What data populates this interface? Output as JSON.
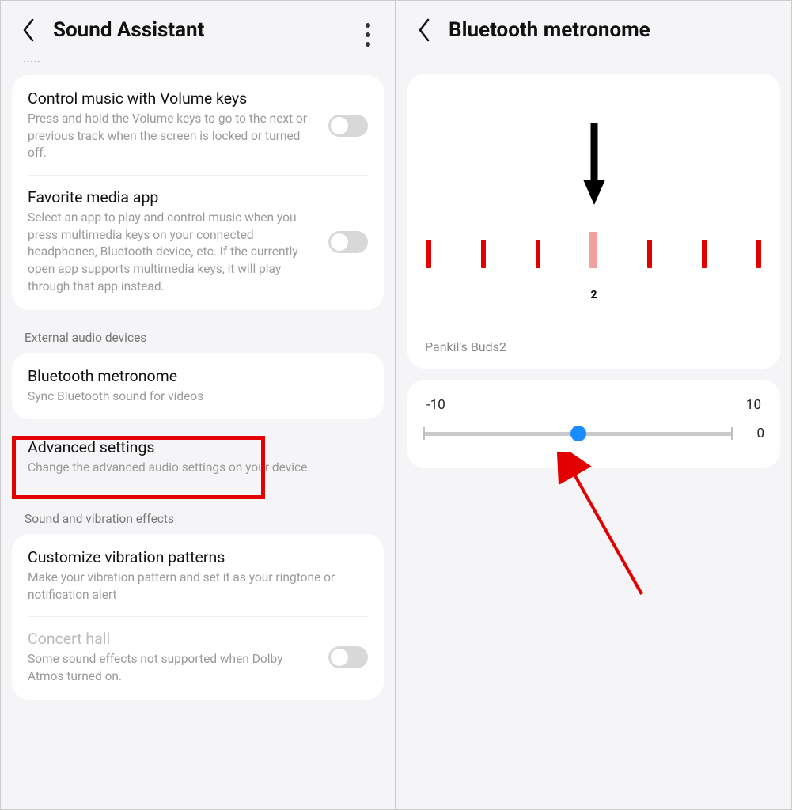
{
  "left": {
    "title": "Sound Assistant",
    "truncated_label": "…",
    "items": {
      "control_music": {
        "title": "Control music with Volume keys",
        "sub": "Press and hold the Volume keys to go to the next or previous track when the screen is locked or turned off."
      },
      "favorite_app": {
        "title": "Favorite media app",
        "sub": "Select an app to play and control music when you press multimedia keys on your connected headphones, Bluetooth device, etc. If the currently open app supports multimedia keys, it will play through that app instead."
      },
      "external_section": "External audio devices",
      "bluetooth_metronome": {
        "title": "Bluetooth metronome",
        "sub": "Sync Bluetooth sound for videos"
      },
      "advanced": {
        "title": "Advanced settings",
        "sub": "Change the advanced audio settings on your device."
      },
      "sound_effects_section": "Sound and vibration effects",
      "custom_vibration": {
        "title": "Customize vibration patterns",
        "sub": "Make your vibration pattern and set it as your ringtone or notification alert"
      },
      "concert_hall": {
        "title": "Concert hall",
        "sub": "Some sound effects not supported when Dolby Atmos turned on."
      }
    }
  },
  "right": {
    "title": "Bluetooth metronome",
    "tick_label": "2",
    "device_name": "Pankil's Buds2",
    "slider": {
      "min_label": "-10",
      "max_label": "10",
      "value": "0"
    }
  }
}
